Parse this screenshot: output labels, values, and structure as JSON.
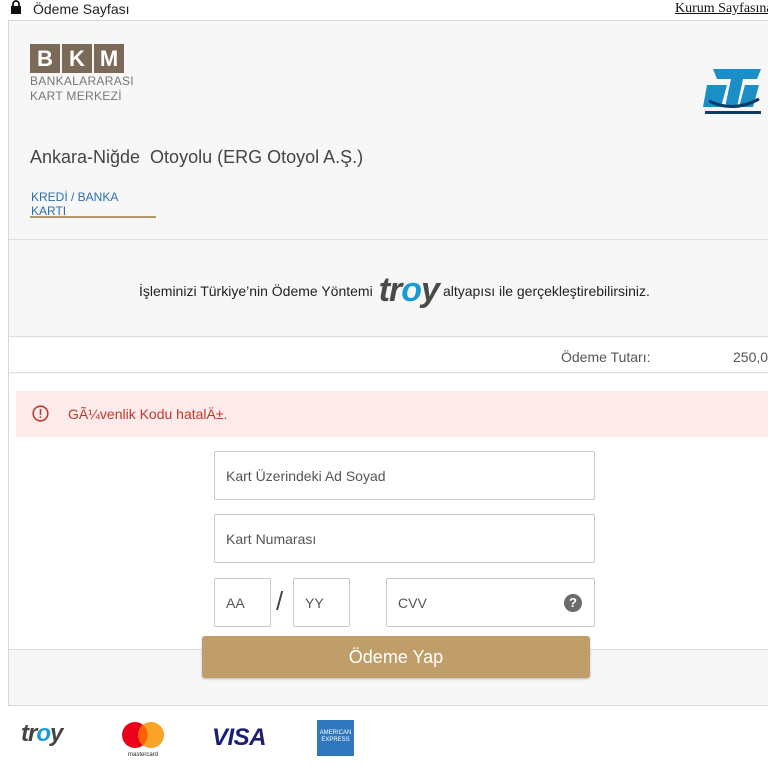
{
  "topbar": {
    "title": "Ödeme Sayfası",
    "kurum_link": "Kurum Sayfasına"
  },
  "header": {
    "bkm_letters": [
      "B",
      "K",
      "M"
    ],
    "bkm_line1": "BANKALARARASI",
    "bkm_line2": "KART MERKEZİ",
    "merchant_name": "Ankara-Niğde  Otoyolu (ERG Otoyol A.Ş.)",
    "tab_label": "KREDİ / BANKA KARTI"
  },
  "troy_banner": {
    "before": "İşleminizi Türkiye’nin Ödeme Yöntemi",
    "troy_pre": "tr",
    "troy_o": "o",
    "troy_post": "y",
    "after": "altyapısı ile gerçekleştirebilirsiniz."
  },
  "amount": {
    "label": "Ödeme Tutarı:",
    "value": "250,0"
  },
  "alert": {
    "message": "GÃ¼venlik Kodu hatalÄ±."
  },
  "form": {
    "name_placeholder": "Kart Üzerindeki Ad Soyad",
    "card_placeholder": "Kart Numarası",
    "month_placeholder": "AA",
    "separator": "/",
    "year_placeholder": "YY",
    "cvv_placeholder": "CVV",
    "help_glyph": "?"
  },
  "pay_button": "Ödeme Yap",
  "brands": {
    "troy_pre": "tr",
    "troy_o": "o",
    "troy_post": "y",
    "visa": "VISA",
    "amex_line1": "AMERICAN",
    "amex_line2": "EXPRESS"
  },
  "colors": {
    "accent_gold": "#bf9e6a",
    "link_blue": "#2a6fb0",
    "error_red": "#c0392b",
    "error_bg": "#fcebea"
  }
}
